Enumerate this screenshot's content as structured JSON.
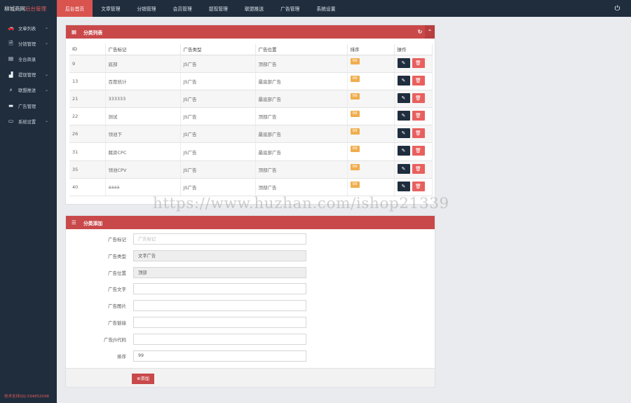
{
  "brand": {
    "main": "柳城商网",
    "accent": "后台管理"
  },
  "nav": [
    "后台首页",
    "文章管理",
    "分销管理",
    "会员管理",
    "提现管理",
    "联盟推送",
    "广告管理",
    "系统设置"
  ],
  "sidebar": {
    "items": [
      {
        "label": "文章列表",
        "icon": "car-icon",
        "glyph": "🚗",
        "chevron": true
      },
      {
        "label": "分销管理",
        "icon": "file-icon",
        "glyph": "🗎",
        "chevron": true
      },
      {
        "label": "全台商录",
        "icon": "card-icon",
        "glyph": "▤",
        "chevron": false
      },
      {
        "label": "提现管理",
        "icon": "bar-chart-icon",
        "glyph": "▟",
        "chevron": true
      },
      {
        "label": "联盟推送",
        "icon": "bolt-icon",
        "glyph": "⚡",
        "chevron": true
      },
      {
        "label": "广告管理",
        "icon": "briefcase-icon",
        "glyph": "▬",
        "chevron": false
      },
      {
        "label": "系统设置",
        "icon": "laptop-icon",
        "glyph": "▭",
        "chevron": true
      }
    ],
    "footnote": "技术支持QQ:334852048"
  },
  "list_panel": {
    "title": "分类列表",
    "columns": [
      "ID",
      "广告标记",
      "广告类型",
      "广告位置",
      "排序",
      "操作"
    ],
    "rows": [
      {
        "id": "9",
        "mark": "底部",
        "type": "JS广告",
        "position": "顶部广告",
        "order": "99"
      },
      {
        "id": "13",
        "mark": "百度统计",
        "type": "JS广告",
        "position": "最底部广告",
        "order": "99"
      },
      {
        "id": "21",
        "mark": "333333",
        "type": "JS广告",
        "position": "最底部广告",
        "order": "99"
      },
      {
        "id": "22",
        "mark": "测试",
        "type": "JS广告",
        "position": "顶部广告",
        "order": "99"
      },
      {
        "id": "26",
        "mark": "领池下",
        "type": "JS广告",
        "position": "最底部广告",
        "order": "99"
      },
      {
        "id": "31",
        "mark": "赭资CPC",
        "type": "JS广告",
        "position": "最底部广告",
        "order": "99"
      },
      {
        "id": "35",
        "mark": "领池CPV",
        "type": "JS广告",
        "position": "顶部广告",
        "order": "99"
      },
      {
        "id": "40",
        "mark": "aaaa",
        "type": "JS广告",
        "position": "顶部广告",
        "order": "99"
      }
    ]
  },
  "form_panel": {
    "title": "分类添加",
    "fields": [
      {
        "label": "广告标记",
        "value": "",
        "placeholder": "广告标记",
        "readonly": false
      },
      {
        "label": "广告类型",
        "value": "文字广告",
        "placeholder": "",
        "readonly": true
      },
      {
        "label": "广告位置",
        "value": "顶部",
        "placeholder": "",
        "readonly": true
      },
      {
        "label": "广告文字",
        "value": "",
        "placeholder": "",
        "readonly": false
      },
      {
        "label": "广告图片",
        "value": "",
        "placeholder": "",
        "readonly": false
      },
      {
        "label": "广告链接",
        "value": "",
        "placeholder": "",
        "readonly": false
      },
      {
        "label": "广告JS代码",
        "value": "",
        "placeholder": "",
        "readonly": false
      },
      {
        "label": "排序",
        "value": "99",
        "placeholder": "",
        "readonly": false
      }
    ],
    "submit_label": "⊕添加"
  },
  "watermark": "https://www.huzhan.com/ishop21339",
  "colors": {
    "sidebar": "#1f2d3d",
    "accent": "#c9494a",
    "badge": "#f0ad4e",
    "delete": "#e8605e"
  }
}
